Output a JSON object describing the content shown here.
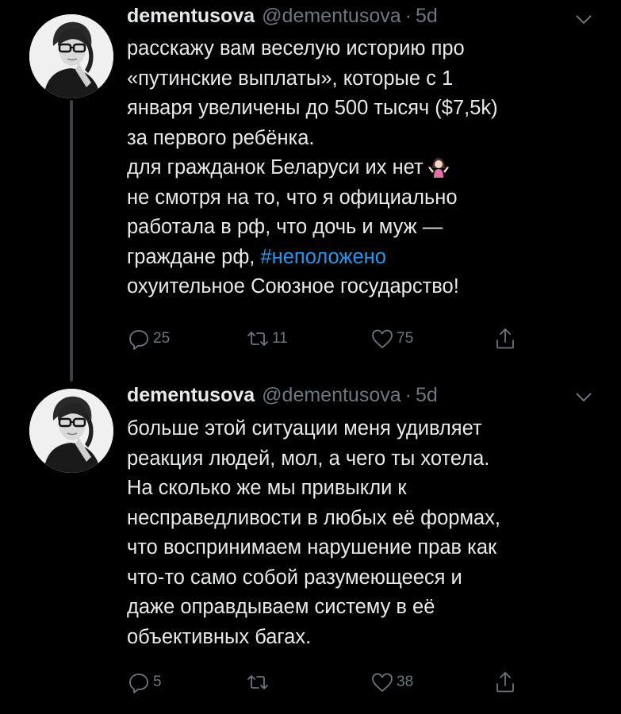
{
  "colors": {
    "background": "#000000",
    "text_primary": "#e7e9ea",
    "text_secondary": "#6e767d",
    "hashtag": "#1d9bf0",
    "thread_line": "#3d4043"
  },
  "icons": {
    "more": "chevron-down-icon",
    "reply": "reply-icon",
    "retweet": "retweet-icon",
    "like": "heart-icon",
    "share": "share-icon",
    "emoji": "person-shrugging-emoji"
  },
  "tweets": [
    {
      "name": "dementusova",
      "handle": "@dementusova",
      "separator": "·",
      "time": "5d",
      "lines": [
        "расскажу вам веселую историю про",
        "«путинские выплаты», которые с 1",
        "января увеличены до 500 тысяч ($7,5k)",
        "за первого ребёнка.",
        "для гражданок Беларуси их нет",
        "не смотря на то, что я официально",
        "работала в рф, что дочь и муж —",
        "граждане рф,",
        "охуительное Союзное государство!"
      ],
      "hashtag": "#неположено",
      "replies": "25",
      "retweets": "11",
      "likes": "75"
    },
    {
      "name": "dementusova",
      "handle": "@dementusova",
      "separator": "·",
      "time": "5d",
      "lines": [
        "больше этой ситуации меня удивляет",
        "реакция людей, мол, а чего ты хотела.",
        "На сколько же мы привыкли к",
        "несправедливости в любых её формах,",
        "что воспринимаем нарушение прав как",
        "что-то само собой разумеющееся и",
        "даже оправдываем систему в её",
        "объективных багах."
      ],
      "replies": "5",
      "retweets": "",
      "likes": "38"
    }
  ]
}
